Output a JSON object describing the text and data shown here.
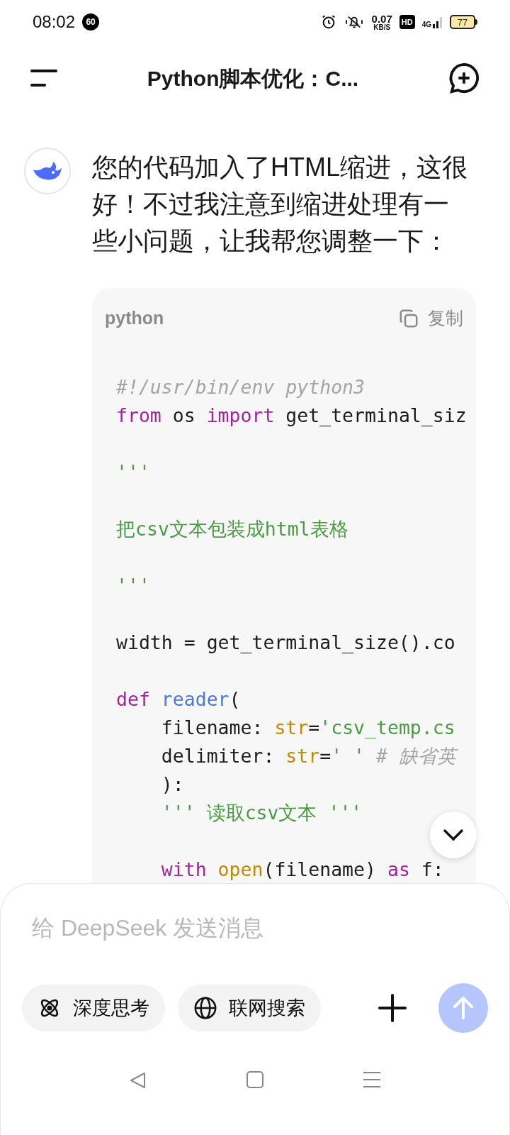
{
  "status_bar": {
    "time": "08:02",
    "badge": "60",
    "net_speed": "0.07",
    "net_unit": "KB/S",
    "hd": "HD",
    "network": "4G",
    "battery": "77"
  },
  "header": {
    "title": "Python脚本优化：C..."
  },
  "message": {
    "text": "您的代码加入了HTML缩进，这很好！不过我注意到缩进处理有一些小问题，让我帮您调整一下：",
    "code": {
      "language": "python",
      "copy_label": "复制",
      "lines": [
        {
          "kind": "code",
          "tokens": [
            {
              "kind": "comment",
              "text": "#!/usr/bin/env python3"
            }
          ]
        },
        {
          "kind": "code",
          "tokens": [
            {
              "kind": "keyword",
              "text": "from"
            },
            {
              "kind": "plain",
              "text": " os "
            },
            {
              "kind": "keyword",
              "text": "import"
            },
            {
              "kind": "plain",
              "text": " get_terminal_siz"
            }
          ]
        },
        {
          "kind": "blank"
        },
        {
          "kind": "code",
          "tokens": [
            {
              "kind": "string",
              "text": "'''"
            }
          ]
        },
        {
          "kind": "blank"
        },
        {
          "kind": "code",
          "tokens": [
            {
              "kind": "string",
              "text": "把csv文本包装成html表格"
            }
          ]
        },
        {
          "kind": "blank"
        },
        {
          "kind": "code",
          "tokens": [
            {
              "kind": "string",
              "text": "'''"
            }
          ]
        },
        {
          "kind": "blank"
        },
        {
          "kind": "code",
          "tokens": [
            {
              "kind": "plain",
              "text": "width = get_terminal_size().co"
            }
          ]
        },
        {
          "kind": "blank"
        },
        {
          "kind": "code",
          "tokens": [
            {
              "kind": "keyword",
              "text": "def"
            },
            {
              "kind": "function",
              "text": " reader"
            },
            {
              "kind": "plain",
              "text": "("
            }
          ]
        },
        {
          "kind": "code",
          "tokens": [
            {
              "kind": "plain",
              "text": "    filename: "
            },
            {
              "kind": "builtin",
              "text": "str"
            },
            {
              "kind": "plain",
              "text": "="
            },
            {
              "kind": "string",
              "text": "'csv_temp.cs"
            }
          ]
        },
        {
          "kind": "code",
          "tokens": [
            {
              "kind": "plain",
              "text": "    delimiter: "
            },
            {
              "kind": "builtin",
              "text": "str"
            },
            {
              "kind": "plain",
              "text": "="
            },
            {
              "kind": "string",
              "text": "' '"
            },
            {
              "kind": "comment",
              "text": " # 缺省英"
            }
          ]
        },
        {
          "kind": "code",
          "tokens": [
            {
              "kind": "plain",
              "text": "    ):"
            }
          ]
        },
        {
          "kind": "code",
          "tokens": [
            {
              "kind": "string",
              "text": "    ''' 读取csv文本 '''"
            }
          ]
        },
        {
          "kind": "blank"
        },
        {
          "kind": "code",
          "tokens": [
            {
              "kind": "keyword",
              "text": "    with"
            },
            {
              "kind": "builtin",
              "text": " open"
            },
            {
              "kind": "plain",
              "text": "(filename) "
            },
            {
              "kind": "keyword",
              "text": "as"
            },
            {
              "kind": "plain",
              "text": " f:"
            }
          ]
        }
      ]
    }
  },
  "composer": {
    "placeholder": "给 DeepSeek 发送消息",
    "chips": [
      {
        "kind": "think",
        "label": "深度思考",
        "selected": false
      },
      {
        "kind": "search",
        "label": "联网搜索",
        "selected": false
      }
    ],
    "send_disabled": true
  }
}
